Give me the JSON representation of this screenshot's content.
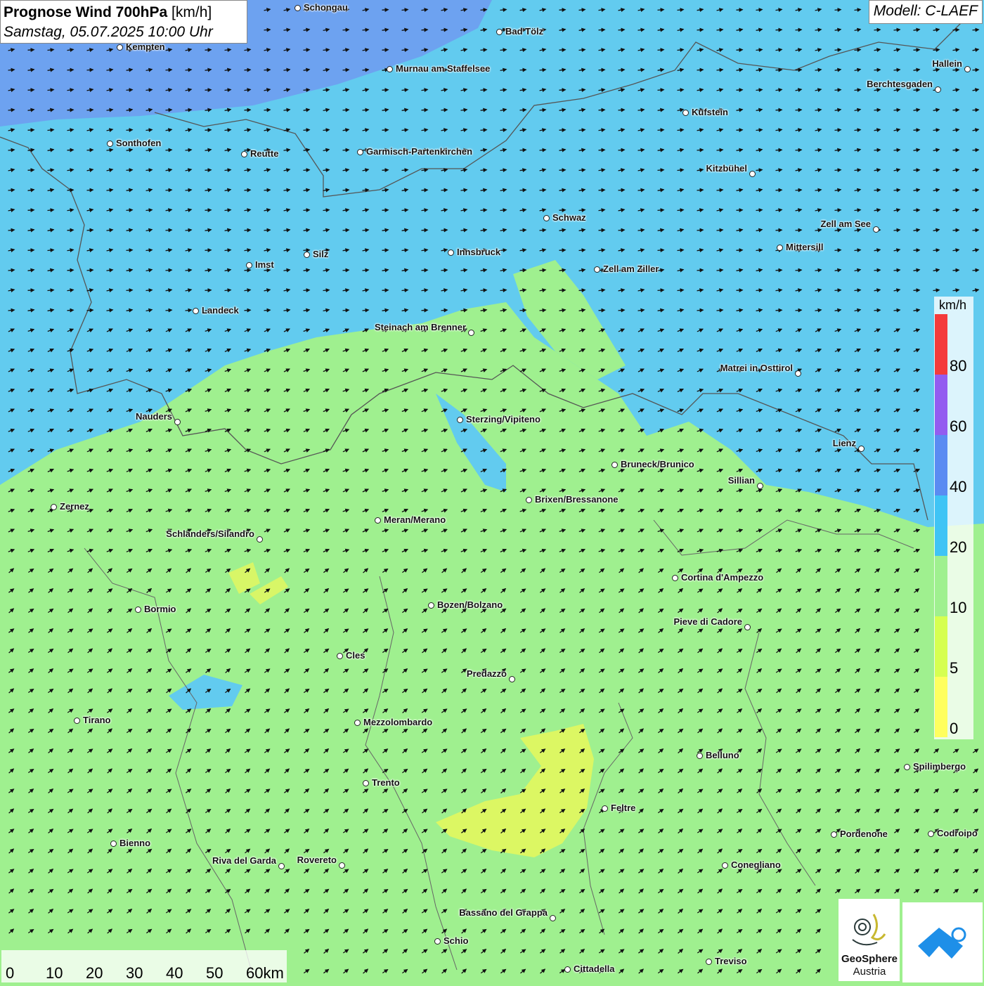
{
  "header": {
    "title": "Prognose Wind 700hPa",
    "unit_suffix": "[km/h]",
    "subtitle": "Samstag, 05.07.2025 10:00 Uhr",
    "model": "Modell: C-LAEF"
  },
  "legend": {
    "unit": "km/h",
    "ticks": [
      "0",
      "5",
      "10",
      "20",
      "40",
      "60",
      "80"
    ],
    "colors": [
      "#ffff5e",
      "#d6ff50",
      "#9ff08f",
      "#3fc4f5",
      "#5a8bf2",
      "#935cf0",
      "#f43b3b"
    ]
  },
  "map": {
    "wind_direction": "from west-southwest",
    "colors": {
      "calm": "#e6f85c",
      "light": "#9ff08f",
      "moderate": "#62cbef",
      "strong": "#6f9df0",
      "border": "#555555"
    },
    "cities": [
      {
        "name": "Schongau"
      },
      {
        "name": "Bad Tölz"
      },
      {
        "name": "Kempten"
      },
      {
        "name": "Murnau am Staffelsee"
      },
      {
        "name": "Hallein"
      },
      {
        "name": "Berchtesgaden"
      },
      {
        "name": "Kufstein"
      },
      {
        "name": "Sonthofen"
      },
      {
        "name": "Reutte"
      },
      {
        "name": "Garmisch-Partenkirchen"
      },
      {
        "name": "Kitzbühel"
      },
      {
        "name": "Schwaz"
      },
      {
        "name": "Zell am See"
      },
      {
        "name": "Mittersill"
      },
      {
        "name": "Innsbruck"
      },
      {
        "name": "Imst"
      },
      {
        "name": "Silz"
      },
      {
        "name": "Zell am Ziller"
      },
      {
        "name": "Landeck"
      },
      {
        "name": "Steinach am Brenner"
      },
      {
        "name": "Matrei in Osttirol"
      },
      {
        "name": "Nauders"
      },
      {
        "name": "Sterzing/Vipiteno"
      },
      {
        "name": "Lienz"
      },
      {
        "name": "Bruneck/Brunico"
      },
      {
        "name": "Sillian"
      },
      {
        "name": "Brixen/Bressanone"
      },
      {
        "name": "Zernez"
      },
      {
        "name": "Meran/Merano"
      },
      {
        "name": "Schlanders/Silandro"
      },
      {
        "name": "Cortina d'Ampezzo"
      },
      {
        "name": "Bormio"
      },
      {
        "name": "Bozen/Bolzano"
      },
      {
        "name": "Pieve di Cadore"
      },
      {
        "name": "Cles"
      },
      {
        "name": "Predazzo"
      },
      {
        "name": "Tirano"
      },
      {
        "name": "Mezzolombardo"
      },
      {
        "name": "Belluno"
      },
      {
        "name": "Spilimbergo"
      },
      {
        "name": "Trento"
      },
      {
        "name": "Feltre"
      },
      {
        "name": "Pordenone"
      },
      {
        "name": "Codroipo"
      },
      {
        "name": "Bienno"
      },
      {
        "name": "Riva del Garda"
      },
      {
        "name": "Rovereto"
      },
      {
        "name": "Conegliano"
      },
      {
        "name": "Bassano del Grappa"
      },
      {
        "name": "Schio"
      },
      {
        "name": "Treviso"
      },
      {
        "name": "Cittadella"
      }
    ]
  },
  "scale": {
    "labels": [
      "0",
      "10",
      "20",
      "30",
      "40",
      "50",
      "60km"
    ]
  },
  "logos": {
    "geosphere_line1": "GeoSphere",
    "geosphere_line2": "Austria"
  }
}
